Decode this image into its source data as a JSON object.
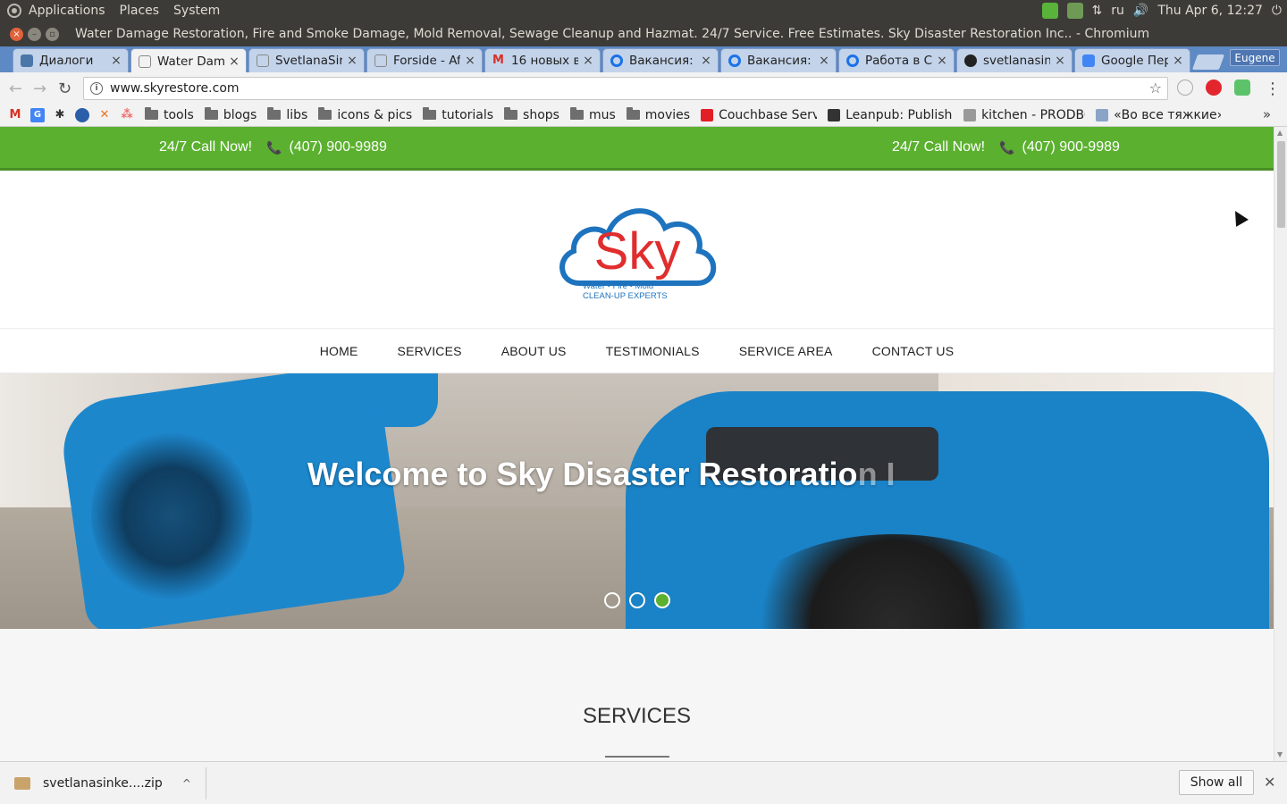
{
  "panel": {
    "menus": [
      "Applications",
      "Places",
      "System"
    ],
    "lang": "ru",
    "datetime": "Thu Apr  6, 12:27"
  },
  "window": {
    "title": "Water Damage Restoration, Fire and Smoke Damage, Mold Removal, Sewage Cleanup and Hazmat. 24/7 Service. Free Estimates. Sky Disaster Restoration Inc.. - Chromium"
  },
  "tabs": [
    {
      "label": "Диалоги",
      "icon": "chat-icon",
      "color": "#4a76a8"
    },
    {
      "label": "Water Dam",
      "icon": "page-icon",
      "color": "#888888",
      "active": true
    },
    {
      "label": "SvetlanaSir",
      "icon": "page-icon",
      "color": "#888888"
    },
    {
      "label": "Forside - Af",
      "icon": "page-icon",
      "color": "#888888"
    },
    {
      "label": "16 новых в",
      "icon": "gmail-icon",
      "color": "#d93025"
    },
    {
      "label": "Вакансия: ",
      "icon": "hh-icon",
      "color": "#1a73e8"
    },
    {
      "label": "Вакансия: ",
      "icon": "hh-icon",
      "color": "#1a73e8"
    },
    {
      "label": "Работа в С",
      "icon": "hh-icon",
      "color": "#1a73e8"
    },
    {
      "label": "svetlanasin",
      "icon": "github-icon",
      "color": "#222222"
    },
    {
      "label": "Google Пер",
      "icon": "translate-icon",
      "color": "#4285f4"
    }
  ],
  "profile": "Eugene",
  "omnibox": {
    "url": "www.skyrestore.com"
  },
  "bookmarks": [
    {
      "label": "tools",
      "type": "folder"
    },
    {
      "label": "blogs",
      "type": "folder"
    },
    {
      "label": "libs",
      "type": "folder"
    },
    {
      "label": "icons & pics",
      "type": "folder"
    },
    {
      "label": "tutorials",
      "type": "folder"
    },
    {
      "label": "shops",
      "type": "folder"
    },
    {
      "label": "mus",
      "type": "folder"
    },
    {
      "label": "movies",
      "type": "folder"
    },
    {
      "label": "Couchbase Server",
      "type": "link"
    },
    {
      "label": "Leanpub: Publish E",
      "type": "link"
    },
    {
      "label": "kitchen - PRODBO",
      "type": "link"
    },
    {
      "label": "«Во все тяжкие» ",
      "type": "link"
    }
  ],
  "site": {
    "call_left": {
      "label": "24/7 Call Now!",
      "phone": "(407) 900-9989"
    },
    "call_right": {
      "label": "24/7 Call Now!",
      "phone": "(407) 900-9989"
    },
    "logo": {
      "word": "Sky",
      "tagline1": "Water • Fire • Mold",
      "tagline2": "CLEAN-UP EXPERTS",
      "blue": "#1e73be",
      "red": "#e02d2d",
      "green": "#5bb12f"
    },
    "nav": [
      "HOME",
      "SERVICES",
      "ABOUT US",
      "TESTIMONIALS",
      "SERVICE AREA",
      "CONTACT US"
    ],
    "hero": {
      "title": "Welcome to Sky Disaster Restoratio",
      "title_fade": "n I",
      "slides": 3,
      "active_slide": 3
    },
    "services_heading": "SERVICES",
    "accent": "#5bb12f"
  },
  "download": {
    "file": "svetlanasinke....zip",
    "show_all": "Show all"
  }
}
